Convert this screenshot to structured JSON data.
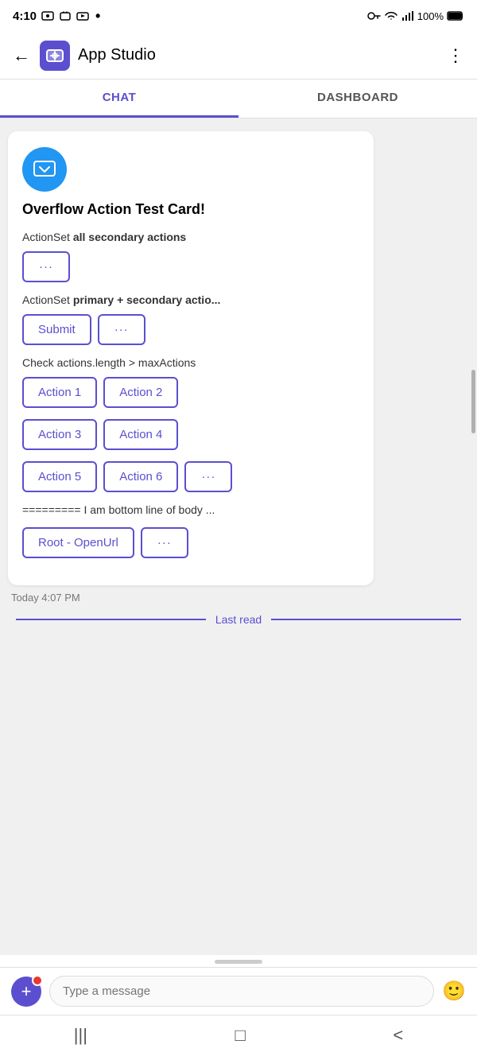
{
  "statusBar": {
    "time": "4:10",
    "battery": "100%"
  },
  "topBar": {
    "backLabel": "←",
    "appName": "App Studio",
    "moreLabel": "⋮"
  },
  "tabs": [
    {
      "label": "CHAT",
      "active": true
    },
    {
      "label": "DASHBOARD",
      "active": false
    }
  ],
  "card": {
    "title": "Overflow Action Test Card!",
    "section1Label": "ActionSet",
    "section1Bold": "all secondary actions",
    "section1Buttons": [
      {
        "label": "···",
        "type": "dots"
      }
    ],
    "section2Label": "ActionSet",
    "section2Bold": "primary + secondary actio...",
    "section2Buttons": [
      {
        "label": "Submit",
        "type": "normal"
      },
      {
        "label": "···",
        "type": "dots"
      }
    ],
    "section3Label": "Check actions.length > maxActions",
    "section3Rows": [
      [
        {
          "label": "Action 1",
          "type": "normal"
        },
        {
          "label": "Action 2",
          "type": "normal"
        }
      ],
      [
        {
          "label": "Action 3",
          "type": "normal"
        },
        {
          "label": "Action 4",
          "type": "normal"
        }
      ],
      [
        {
          "label": "Action 5",
          "type": "normal"
        },
        {
          "label": "Action 6",
          "type": "normal"
        },
        {
          "label": "···",
          "type": "dots"
        }
      ]
    ],
    "bottomLine": "========= I am bottom line of body ...",
    "footerButtons": [
      {
        "label": "Root - OpenUrl",
        "type": "normal"
      },
      {
        "label": "···",
        "type": "dots"
      }
    ]
  },
  "timestamp": "Today 4:07 PM",
  "lastRead": "Last read",
  "inputPlaceholder": "Type a message",
  "navItems": [
    "|||",
    "□",
    "<"
  ]
}
